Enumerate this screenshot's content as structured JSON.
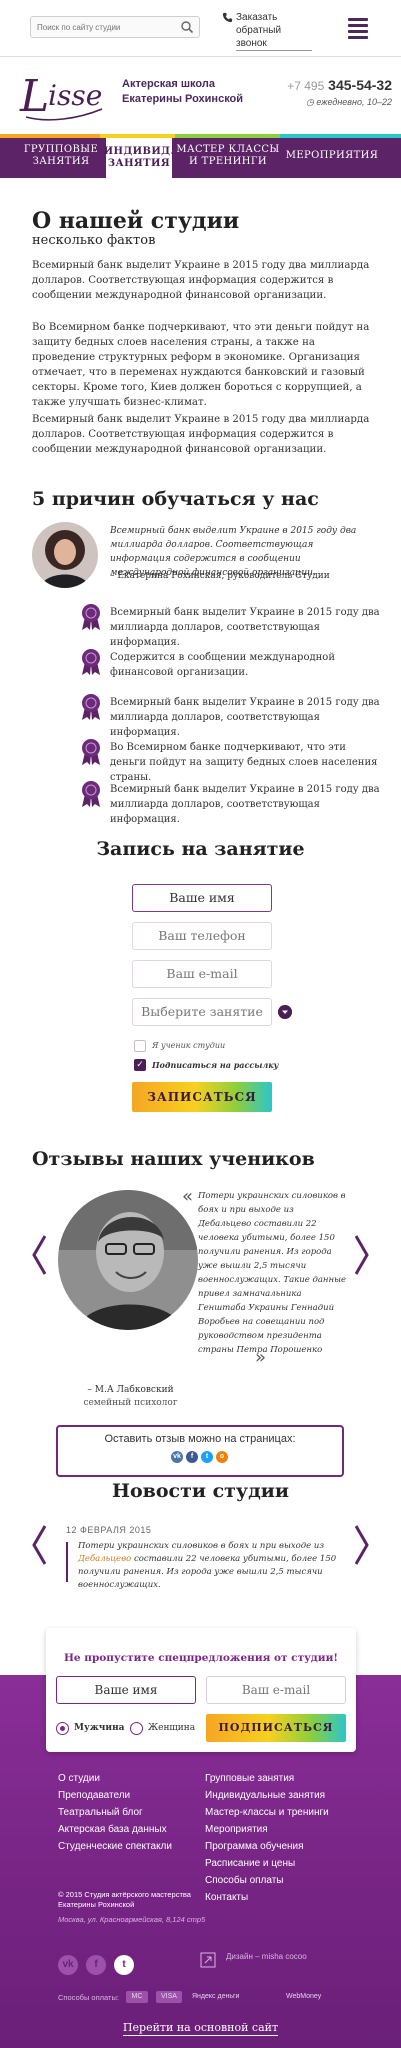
{
  "search": {
    "placeholder": "Поиск по сайту студии"
  },
  "callback": {
    "label": "Заказать обратный звонок"
  },
  "header": {
    "school_line1": "Актерская школа",
    "school_line2": "Екатерины Рохинской",
    "phone_prefix": "+7 495",
    "phone_number": "345-54-32",
    "hours": "ежедневно, 10–22"
  },
  "nav": [
    {
      "label": "Групповые занятия",
      "color": "#f5a623"
    },
    {
      "label": "Индивид. занятия",
      "color": "#f7d020"
    },
    {
      "label": "Мастер классы и тренинги",
      "color": "#8ccf3c"
    },
    {
      "label": "Мероприятия",
      "color": "#2bc6c9"
    }
  ],
  "about": {
    "title": "О нашей студии",
    "subtitle": "несколько фактов",
    "p1": "Всемирный банк выделит Украине в 2015 году два миллиарда долларов. Соответствующая информация содержится в сообщении международной финансовой организации.",
    "p2": "Во Всемирном банке подчеркивают, что эти деньги пойдут на защиту бедных слоев населения страны, а также на проведение структурных реформ в экономике. Организация отмечает, что в переменах нуждаются банковский и газовый секторы. Кроме того, Киев должен бороться с коррупцией, а также улучшать бизнес-климат.",
    "p3": "Всемирный банк выделит Украине в 2015 году два миллиарда долларов. Соответствующая информация содержится в сообщении международной финансовой организации."
  },
  "reasons": {
    "title": "5 причин обучаться у нас",
    "quote": "Всемирный банк выделит Украине в 2015 году два миллиарда долларов. Соответствующая информация содержится в сообщении международной финансовой организации.",
    "quote_author": "– Екатерина Рохинская, руководитель Студии",
    "items": [
      "Всемирный банк выделит Украине в 2015 году два миллиарда долларов, соответствующая информация.",
      "Содержится в сообщении международной финансовой организации.",
      "Всемирный банк выделит Украине в 2015 году два миллиарда долларов, соответствующая информация.",
      "Во Всемирном банке подчеркивают, что эти деньги пойдут на защиту бедных слоев населения страны.",
      "Всемирный банк выделит Украине в 2015 году два миллиарда долларов, соответствующая информация."
    ]
  },
  "signup": {
    "title": "Запись на занятие",
    "name_placeholder": "Ваше имя",
    "phone_placeholder": "Ваш телефон",
    "email_placeholder": "Ваш e-mail",
    "class_select": "Выберите занятие",
    "check_student": "Я ученик студии",
    "check_newsletter": "Подписаться на рассылку",
    "submit": "ЗАПИСАТЬСЯ"
  },
  "reviews": {
    "title": "Отзывы наших учеников",
    "text": "Потери украинских силовиков в боях и при выходе из Дебальцево составили 22 человека убитыми, более 150 получили ранения. Из города уже вышли 2,5 тысячи военнослужащих. Такие данные привел замначальника Генштаба Украины Геннадий Воробьев на совещании под руководством президента страны Петра Порошенко",
    "author": "– М.А Лабковский",
    "role": "семейный психолог",
    "leave_review": "Оставить отзыв можно на страницах:"
  },
  "news": {
    "title": "Новости студии",
    "date": "12 ФЕВРАЛЯ 2015",
    "text_before": "Потери украинских силовиков в боях и при выходе из ",
    "text_link": "Дебальцево",
    "text_after": " составили 22 человека убитыми, более 150 получили ранения. Из города уже вышли 2,5 тысячи военнослужащих."
  },
  "promo": {
    "title": "Не пропустите спецпредложения от студии!",
    "name_placeholder": "Ваше имя",
    "email_placeholder": "Ваш e-mail",
    "male": "Мужчина",
    "female": "Женщина",
    "submit": "ПОДПИСАТЬСЯ"
  },
  "footer": {
    "col1": [
      "О студии",
      "Преподаватели",
      "Театральный блог",
      "Актерская база данных",
      "Студенческие спектакли"
    ],
    "col2": [
      "Групповые занятия",
      "Индивидуальные занятия",
      "Мастер-классы и тренинги",
      "Мероприятия",
      "Программа обучения",
      "Расписание и цены",
      "Способы оплаты",
      "Контакты"
    ],
    "copyright": "© 2015 Студия актёрского мастерства Екатерины Рохинской",
    "address": "Москва, ул. Красноармейская, 8,124 стр5",
    "design": "Дизайн – misha cocoo",
    "payments_label": "Способы оплаты:",
    "pay_yandex": "Яндекс деньги",
    "pay_webmoney": "WebMoney",
    "main_site": "Перейти на основной сайт"
  },
  "colors": {
    "brand": "#5c2366",
    "footer": "#7a2688"
  }
}
